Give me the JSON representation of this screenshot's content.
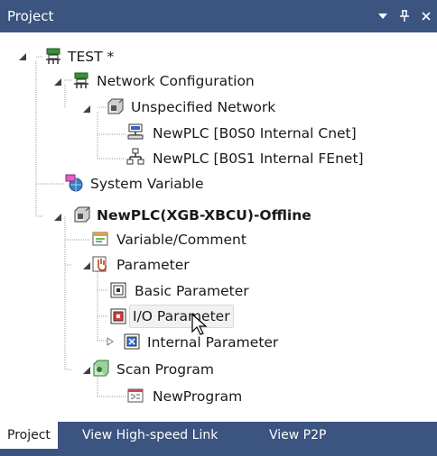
{
  "panel": {
    "title": "Project"
  },
  "tree": {
    "root": "TEST *",
    "network_configuration": "Network Configuration",
    "unspecified_network": "Unspecified Network",
    "cnet_plc": "NewPLC [B0S0 Internal Cnet]",
    "fenet_plc": "NewPLC [B0S1 Internal FEnet]",
    "system_variable": "System Variable",
    "plc": "NewPLC(XGB-XBCU)-Offline",
    "variable_comment": "Variable/Comment",
    "parameter": "Parameter",
    "basic_parameter": "Basic Parameter",
    "io_parameter": "I/O Parameter",
    "internal_parameter": "Internal Parameter",
    "scan_program": "Scan Program",
    "new_program": "NewProgram"
  },
  "tabs": [
    "Project",
    "View High-speed Link",
    "View P2P"
  ],
  "colors": {
    "titlebar": "#3b5480",
    "tree_line": "#a0a0a0",
    "selection": "#f1f1f1"
  }
}
